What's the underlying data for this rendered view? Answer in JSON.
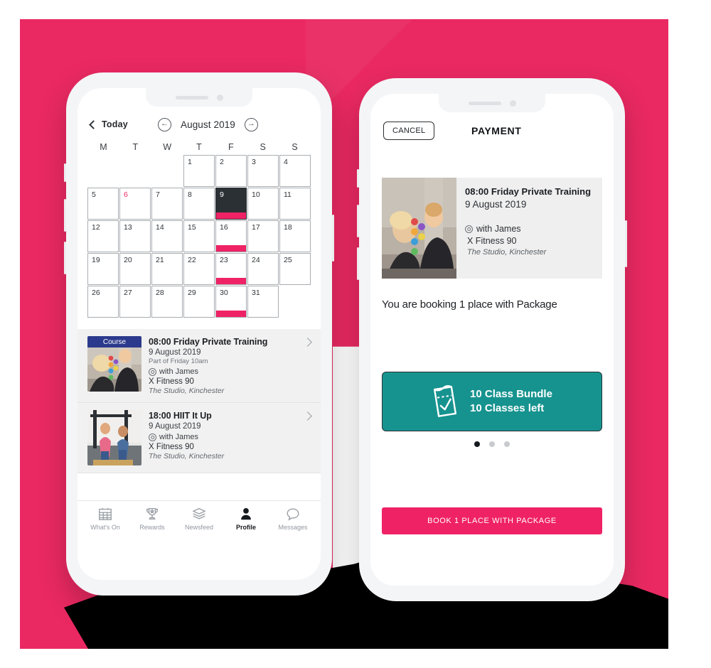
{
  "theme": {
    "brand_pink": "#ea2962",
    "accent_pink": "#ef2265",
    "teal": "#17938f",
    "dark": "#2b3035",
    "ribbon_blue": "#2b3a8c"
  },
  "left_phone": {
    "calendar": {
      "today_label": "Today",
      "month_label": "August 2019",
      "prev_icon": "arrow-left-circle-icon",
      "next_icon": "arrow-right-circle-icon",
      "day_initials": [
        "M",
        "T",
        "W",
        "T",
        "F",
        "S",
        "S"
      ],
      "leading_blanks": 3,
      "days": [
        {
          "n": 1
        },
        {
          "n": 2
        },
        {
          "n": 3
        },
        {
          "n": 4
        },
        {
          "n": 5
        },
        {
          "n": 6,
          "today": true
        },
        {
          "n": 7
        },
        {
          "n": 8
        },
        {
          "n": 9,
          "selected": true,
          "event": true
        },
        {
          "n": 10
        },
        {
          "n": 11
        },
        {
          "n": 12
        },
        {
          "n": 13
        },
        {
          "n": 14
        },
        {
          "n": 15
        },
        {
          "n": 16,
          "event": true
        },
        {
          "n": 17
        },
        {
          "n": 18
        },
        {
          "n": 19
        },
        {
          "n": 20
        },
        {
          "n": 21
        },
        {
          "n": 22
        },
        {
          "n": 23,
          "event": true
        },
        {
          "n": 24
        },
        {
          "n": 25
        },
        {
          "n": 26
        },
        {
          "n": 27
        },
        {
          "n": 28
        },
        {
          "n": 29
        },
        {
          "n": 30,
          "event": true
        },
        {
          "n": 31
        }
      ]
    },
    "events": [
      {
        "badge": "Course",
        "title": "08:00 Friday Private Training",
        "date": "9 August 2019",
        "part_of": "Part of Friday 10am",
        "instructor": "with James",
        "package": "X Fitness 90",
        "location": "The Studio, Kinchester",
        "chevron_icon": "chevron-right-icon"
      },
      {
        "badge": "",
        "title": "18:00 HIIT It Up",
        "date": "9 August 2019",
        "part_of": "",
        "instructor": "with James",
        "package": "X Fitness 90",
        "location": "The Studio, Kinchester",
        "chevron_icon": "chevron-right-icon"
      }
    ],
    "tabbar": [
      {
        "label": "What's On",
        "icon": "calendar-icon",
        "active": false
      },
      {
        "label": "Rewards",
        "icon": "trophy-icon",
        "active": false
      },
      {
        "label": "Newsfeed",
        "icon": "layers-icon",
        "active": false
      },
      {
        "label": "Profile",
        "icon": "person-icon",
        "active": true
      },
      {
        "label": "Messages",
        "icon": "speech-bubble-icon",
        "active": false
      }
    ]
  },
  "right_phone": {
    "header": {
      "cancel_label": "CANCEL",
      "title": "PAYMENT"
    },
    "booking_card": {
      "title": "08:00 Friday Private Training",
      "date": "9 August 2019",
      "instructor": "with James",
      "package": "X Fitness 90",
      "location": "The Studio, Kinchester",
      "person_icon": "person-circle-icon"
    },
    "booking_note": "You are booking 1 place with Package",
    "package_card": {
      "icon": "voucher-check-icon",
      "line1": "10 Class Bundle",
      "line2": "10 Classes left"
    },
    "carousel": {
      "total": 3,
      "active_index": 0
    },
    "cta_label": "BOOK 1 PLACE WITH PACKAGE"
  }
}
